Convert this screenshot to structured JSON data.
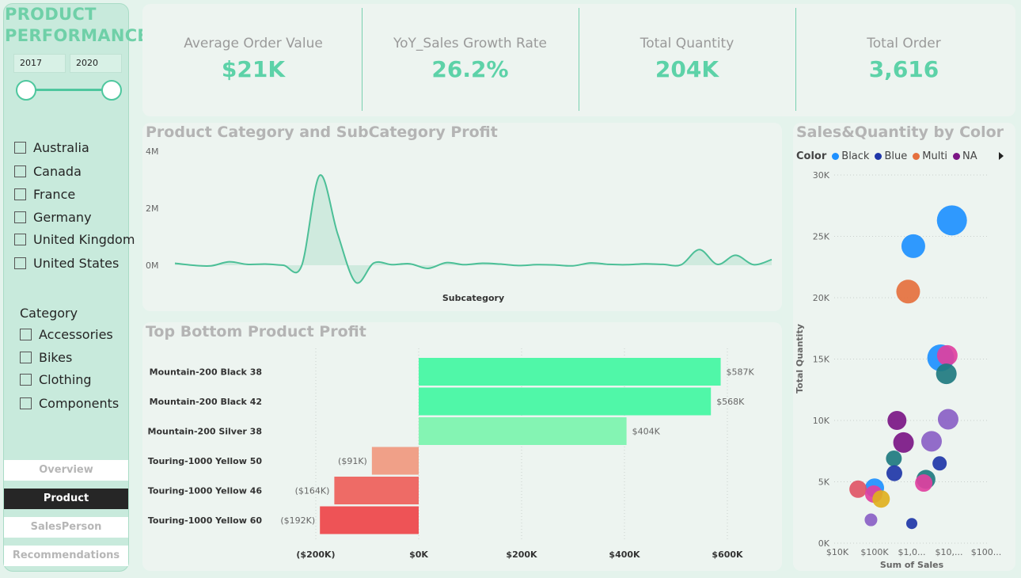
{
  "app_title": "PRODUCT PERFORMANCE",
  "year_range": {
    "start": "2017",
    "end": "2020"
  },
  "countries": [
    "Australia",
    "Canada",
    "France",
    "Germany",
    "United Kingdom",
    "United States"
  ],
  "category_filter": {
    "heading": "Category",
    "items": [
      "Accessories",
      "Bikes",
      "Clothing",
      "Components"
    ]
  },
  "nav": [
    {
      "label": "Overview",
      "active": false
    },
    {
      "label": "Product",
      "active": true
    },
    {
      "label": "SalesPerson",
      "active": false
    },
    {
      "label": "Recommendations",
      "active": false
    }
  ],
  "kpis": [
    {
      "label": "Average Order Value",
      "value": "$21K"
    },
    {
      "label": "YoY_Sales Growth Rate",
      "value": "26.2%"
    },
    {
      "label": "Total Quantity",
      "value": "204K"
    },
    {
      "label": "Total Order",
      "value": "3,616"
    }
  ],
  "colors": {
    "accent": "#5dd2a8",
    "slider": "#4ec79e",
    "line": "#4cbf97",
    "positive_bar": "#50f7a8",
    "negative_bar": "#ee5356"
  },
  "chart_data": [
    {
      "type": "area",
      "title": "Product Category and SubCategory Profit",
      "xlabel": "Subcategory",
      "ylabel": "",
      "ytick_labels": [
        "4M",
        "2M",
        "0M"
      ],
      "ylim": [
        -1,
        4
      ],
      "grid": false,
      "y_millions": [
        0.07,
        0.0,
        -0.02,
        0.12,
        0.03,
        0.04,
        0.0,
        -0.03,
        3.15,
        1.1,
        -0.6,
        0.08,
        0.02,
        0.05,
        -0.11,
        0.09,
        0.02,
        0.07,
        0.04,
        -0.01,
        0.02,
        0.01,
        -0.02,
        0.08,
        0.03,
        0.02,
        0.05,
        0.03,
        0.02,
        0.55,
        0.03,
        0.35,
        0.02,
        0.2
      ]
    },
    {
      "type": "bar",
      "orientation": "horizontal",
      "title": "Top Bottom Product Profit",
      "categories": [
        "Mountain-200 Black 38",
        "Mountain-200 Black 42",
        "Mountain-200 Silver 38",
        "Touring-1000 Yellow 50",
        "Touring-1000 Yellow 46",
        "Touring-1000 Yellow 60"
      ],
      "values": [
        587,
        568,
        404,
        -91,
        -164,
        -192
      ],
      "value_labels": [
        "$587K",
        "$568K",
        "$404K",
        "($91K)",
        "($164K)",
        "($192K)"
      ],
      "bar_colors": [
        "#50f7a8",
        "#50f7a8",
        "#84f4b3",
        "#f0a088",
        "#ee6b66",
        "#ee5356"
      ],
      "xtick_values": [
        -200,
        0,
        200,
        400,
        600
      ],
      "xtick_labels": [
        "($200K)",
        "$0K",
        "$200K",
        "$400K",
        "$600K"
      ],
      "xlim": [
        -300,
        700
      ],
      "grid": true
    },
    {
      "type": "scatter",
      "title": "Sales&Quantity by Color",
      "legend_title": "Color",
      "legend": [
        {
          "name": "Black",
          "color": "#1e90ff"
        },
        {
          "name": "Blue",
          "color": "#1f36a8"
        },
        {
          "name": "Multi",
          "color": "#e5703e"
        },
        {
          "name": "NA",
          "color": "#7b1685"
        }
      ],
      "xlabel": "Sum of Sales",
      "ylabel": "Total Quantity",
      "x_log": true,
      "xtick_labels": [
        "$10K",
        "$100K",
        "$1,0...",
        "$10,...",
        "$100..."
      ],
      "ytick_values": [
        0,
        5000,
        10000,
        15000,
        20000,
        25000,
        30000
      ],
      "ytick_labels": [
        "0K",
        "5K",
        "10K",
        "15K",
        "20K",
        "25K",
        "30K"
      ],
      "ylim": [
        0,
        30000
      ],
      "grid": true,
      "points": [
        {
          "x": 12000000,
          "y": 26300,
          "size": 19,
          "color": "#1e90ff"
        },
        {
          "x": 1100000,
          "y": 24200,
          "size": 15,
          "color": "#1e90ff"
        },
        {
          "x": 800000,
          "y": 20500,
          "size": 15,
          "color": "#e5703e"
        },
        {
          "x": 6000000,
          "y": 15100,
          "size": 17,
          "color": "#1e90ff"
        },
        {
          "x": 9000000,
          "y": 15300,
          "size": 13,
          "color": "#e040a0"
        },
        {
          "x": 8500000,
          "y": 13800,
          "size": 13,
          "color": "#1f7a80"
        },
        {
          "x": 9500000,
          "y": 10100,
          "size": 13,
          "color": "#8a5fc6"
        },
        {
          "x": 400000,
          "y": 10000,
          "size": 12,
          "color": "#7b1685"
        },
        {
          "x": 600000,
          "y": 8200,
          "size": 13,
          "color": "#7b1685"
        },
        {
          "x": 3400000,
          "y": 8300,
          "size": 13,
          "color": "#8a5fc6"
        },
        {
          "x": 330000,
          "y": 6900,
          "size": 10,
          "color": "#1f7a80"
        },
        {
          "x": 5600000,
          "y": 6500,
          "size": 9,
          "color": "#1f36a8"
        },
        {
          "x": 340000,
          "y": 5700,
          "size": 10,
          "color": "#1f36a8"
        },
        {
          "x": 2400000,
          "y": 5200,
          "size": 12,
          "color": "#1f7a80"
        },
        {
          "x": 2100000,
          "y": 4900,
          "size": 11,
          "color": "#e040a0"
        },
        {
          "x": 100000,
          "y": 4500,
          "size": 12,
          "color": "#1e90ff"
        },
        {
          "x": 36000,
          "y": 4400,
          "size": 11,
          "color": "#e05566"
        },
        {
          "x": 95000,
          "y": 4000,
          "size": 11,
          "color": "#e040a0"
        },
        {
          "x": 150000,
          "y": 3600,
          "size": 11,
          "color": "#e0b020"
        },
        {
          "x": 80000,
          "y": 1900,
          "size": 8,
          "color": "#8a5fc6"
        },
        {
          "x": 1000000,
          "y": 1600,
          "size": 7,
          "color": "#1f36a8"
        }
      ]
    }
  ]
}
